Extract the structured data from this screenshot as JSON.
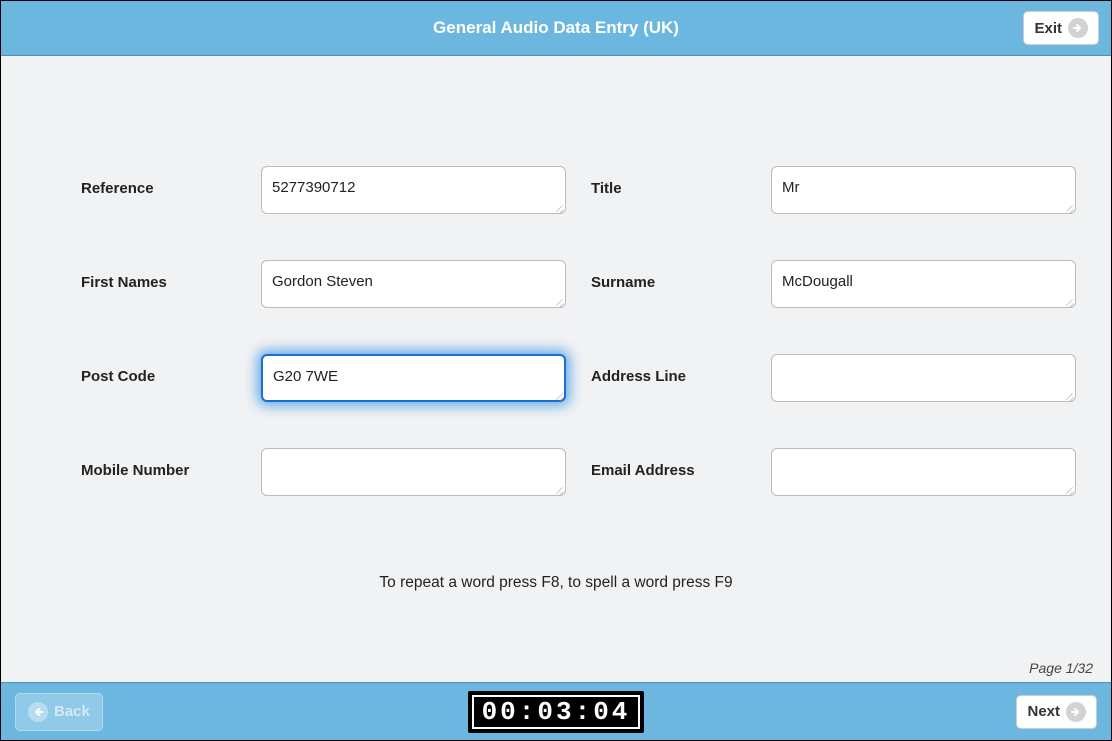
{
  "header": {
    "title": "General Audio Data Entry (UK)",
    "exit_label": "Exit"
  },
  "form": {
    "reference": {
      "label": "Reference",
      "value": "5277390712"
    },
    "title": {
      "label": "Title",
      "value": "Mr"
    },
    "first_names": {
      "label": "First Names",
      "value": "Gordon Steven"
    },
    "surname": {
      "label": "Surname",
      "value": "McDougall"
    },
    "post_code": {
      "label": "Post Code",
      "value": "G20 7WE"
    },
    "address_line": {
      "label": "Address Line",
      "value": ""
    },
    "mobile_number": {
      "label": "Mobile Number",
      "value": ""
    },
    "email_address": {
      "label": "Email Address",
      "value": ""
    }
  },
  "hint_text": "To repeat a word press F8, to spell a word press F9",
  "page_indicator": "Page 1/32",
  "footer": {
    "back_label": "Back",
    "next_label": "Next",
    "timer": "00:03:04"
  }
}
